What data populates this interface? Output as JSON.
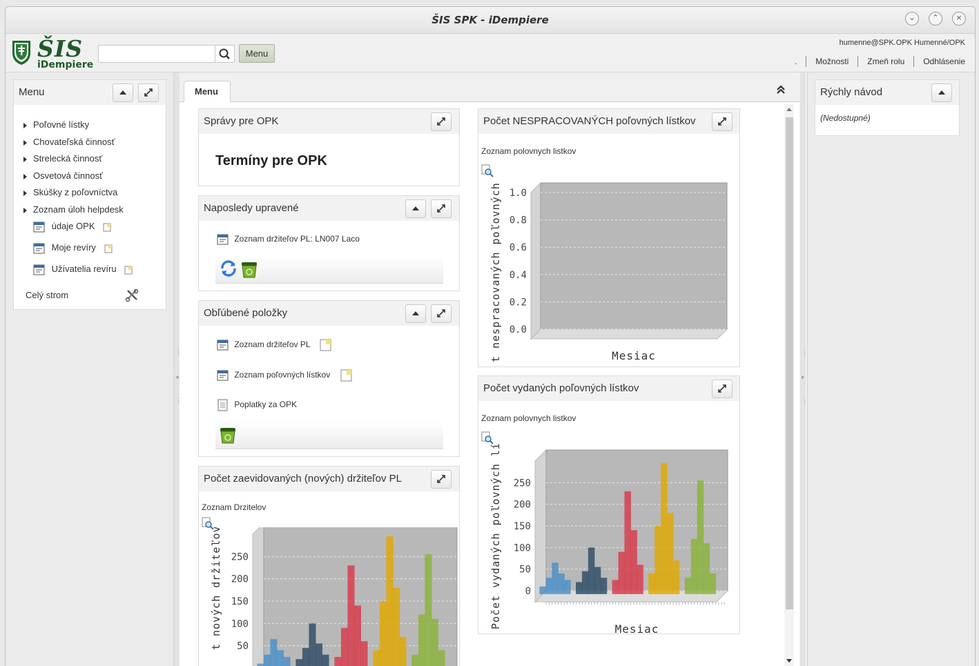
{
  "window": {
    "title": "ŠIS SPK - iDempiere"
  },
  "logo": {
    "brand": "ŠIS",
    "subtitle": "iDempiere"
  },
  "header": {
    "search_placeholder": "",
    "menu_button": "Menu",
    "user": "humenne@SPK.OPK Humenné/OPK",
    "dot": ".",
    "links": {
      "options": "Možnosti",
      "change_role": "Zmeň rolu",
      "logout": "Odhlásenie"
    }
  },
  "left_menu": {
    "title": "Menu",
    "folders": [
      "Poľovné lístky",
      "Chovateľská činnosť",
      "Strelecká činnosť",
      "Osvetová činnosť",
      "Skúšky z poľovníctva",
      "Zoznam úloh helpdesk"
    ],
    "entries": [
      "údaje OPK",
      "Moje revíry",
      "Užívatelia revíru"
    ],
    "full_tree": "Celý strom"
  },
  "tab": {
    "label": "Menu"
  },
  "panels": {
    "reports": {
      "title": "Správy pre OPK",
      "body": "Termíny pre OPK"
    },
    "recent": {
      "title": "Naposledy upravené",
      "item": "Zoznam držiteľov PL: LN007 Laco"
    },
    "favorites": {
      "title": "Obľúbené položky",
      "items": [
        "Zoznam držiteľov PL",
        "Zoznam poľovných lístkov",
        "Poplatky za OPK"
      ]
    },
    "holders": {
      "title": "Počet zaevidovaných (nových) držiteľov PL",
      "subtitle": "Zoznam Drzitelov"
    },
    "unprocessed": {
      "title": "Počet NESPRACOVANÝCH poľovných lístkov",
      "subtitle": "Zoznam polovnych listkov"
    },
    "issued": {
      "title": "Počet vydaných poľovných lístkov",
      "subtitle": "Zoznam polovnych listkov"
    }
  },
  "quick_guide": {
    "title": "Rýchly návod",
    "body": "(Nedostupné)"
  },
  "chart_data": [
    {
      "type": "bar",
      "title": "Počet NESPRACOVANÝCH poľovných lístkov",
      "xlabel": "Mesiac",
      "ylabel": "t nespracovaných poľovných",
      "yticks": [
        "0.0",
        "0.2",
        "0.4",
        "0.6",
        "0.8",
        "1.0"
      ],
      "ylim": [
        0,
        1
      ],
      "values": []
    },
    {
      "type": "bar",
      "title": "Počet vydaných poľovných lístkov",
      "xlabel": "Mesiac",
      "ylabel": "Počet vydaných poľovných lí",
      "yticks": [
        "0",
        "50",
        "100",
        "150",
        "200",
        "250"
      ],
      "ylim": [
        0,
        300
      ],
      "series": [
        {
          "color": "#4a90c8",
          "values": [
            10,
            30,
            65,
            40,
            25
          ]
        },
        {
          "color": "#2e4c66",
          "values": [
            20,
            45,
            100,
            55,
            30
          ]
        },
        {
          "color": "#d83a4a",
          "values": [
            25,
            90,
            230,
            140,
            60
          ]
        },
        {
          "color": "#e0a800",
          "values": [
            40,
            150,
            295,
            180,
            70
          ]
        },
        {
          "color": "#8bb33a",
          "values": [
            30,
            120,
            255,
            110,
            40
          ]
        }
      ]
    },
    {
      "type": "bar",
      "title": "Počet zaevidovaných (nových) držiteľov PL",
      "xlabel": "",
      "ylabel": "t nových držiteľov P",
      "yticks": [
        "50",
        "100",
        "150",
        "200",
        "250"
      ],
      "ylim": [
        0,
        300
      ],
      "series": [
        {
          "color": "#4a90c8",
          "values": [
            10,
            30,
            65,
            40,
            25
          ]
        },
        {
          "color": "#2e4c66",
          "values": [
            20,
            45,
            100,
            55,
            30
          ]
        },
        {
          "color": "#d83a4a",
          "values": [
            25,
            90,
            230,
            140,
            60
          ]
        },
        {
          "color": "#e0a800",
          "values": [
            40,
            150,
            295,
            180,
            70
          ]
        },
        {
          "color": "#8bb33a",
          "values": [
            30,
            120,
            255,
            110,
            40
          ]
        }
      ]
    }
  ]
}
